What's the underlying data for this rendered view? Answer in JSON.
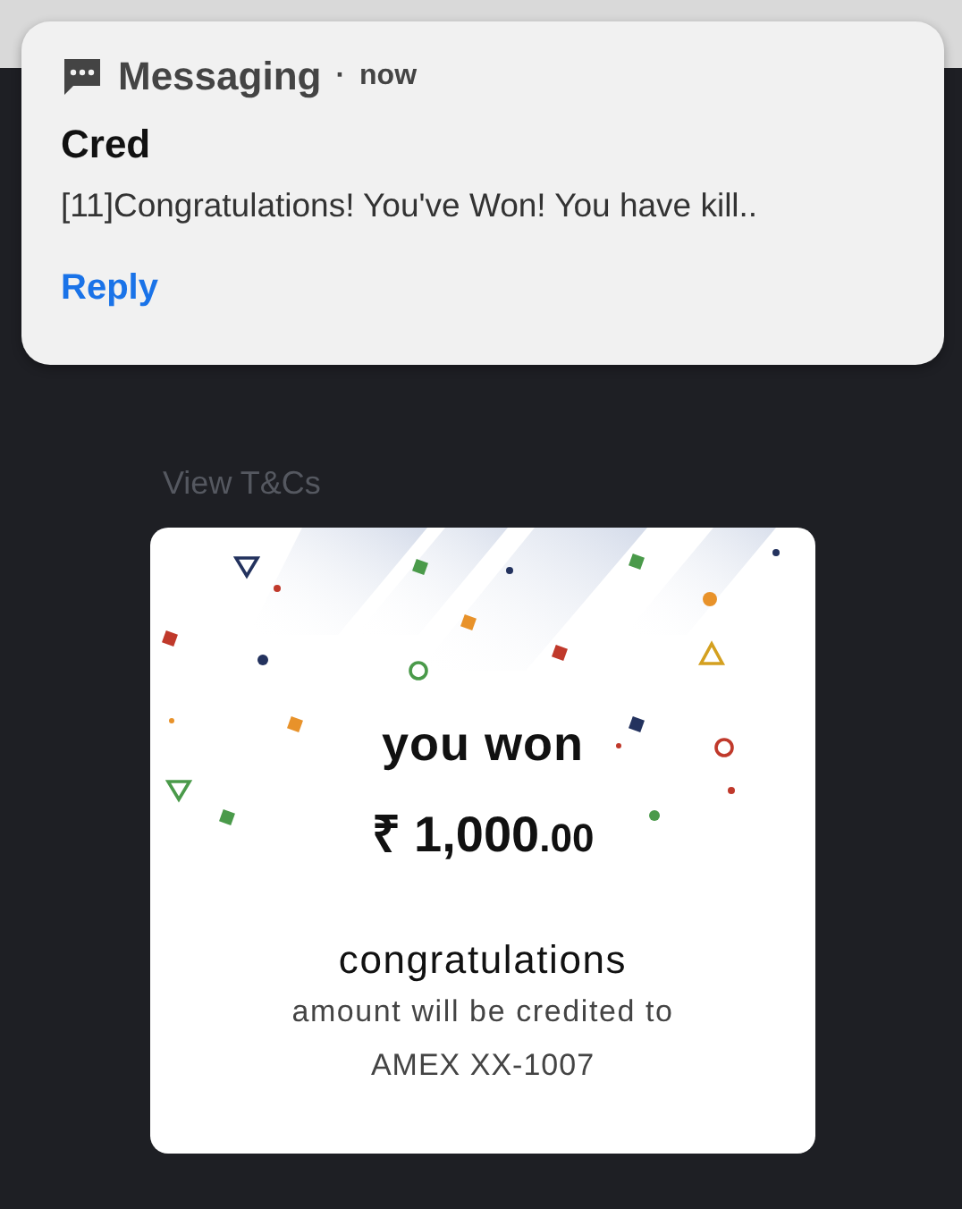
{
  "notification": {
    "app": "Messaging",
    "time": "now",
    "separator": "·",
    "sender": "Cred",
    "message": "[11]Congratulations! You've Won! You have kill..",
    "action": "Reply"
  },
  "terms_link": "View T&Cs",
  "reward_card": {
    "headline": "you won",
    "amount": {
      "whole": "₹ 1,000",
      "fraction": ".00"
    },
    "title": "congratulations",
    "subtitle": "amount will be credited to",
    "account": "AMEX XX-1007"
  }
}
